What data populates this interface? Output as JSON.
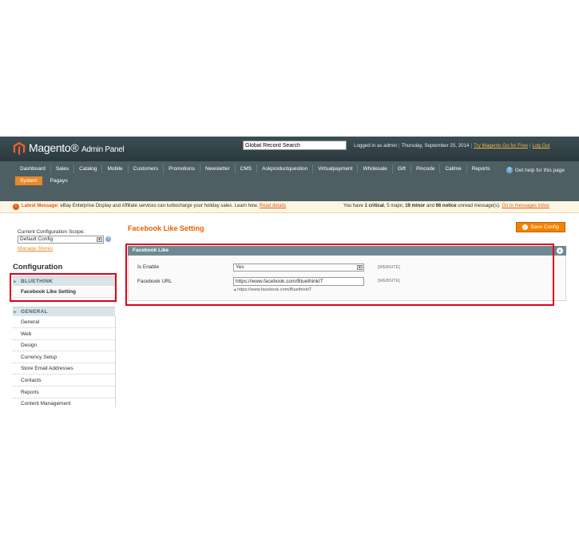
{
  "header": {
    "logo_text": "Magento",
    "logo_sub": "Admin Panel",
    "search_value": "Global Record Search",
    "user_text": "Logged in as admin",
    "date_text": "Thursday, September 25, 2014",
    "try_link": "Try Magento Go for Free",
    "logout_link": "Log Out"
  },
  "nav": {
    "row1": [
      "Dashboard",
      "Sales",
      "Catalog",
      "Mobile",
      "Customers",
      "Promotions",
      "Newsletter",
      "CMS",
      "Askproductquestion",
      "Virtualpayment",
      "Wholesale",
      "Gift",
      "Pincode",
      "Callme",
      "Reports"
    ],
    "row2": [
      "System",
      "Pagayo"
    ],
    "help": "Get help for this page"
  },
  "message": {
    "label": "Latest Message:",
    "text": "eBay Enterprise Display and Affiliate services can turbocharge your holiday sales. Learn how.",
    "read_details": "Read details",
    "summary_prefix": "You have",
    "critical": "1 critical",
    "major": "5 major",
    "minor": "19 minor",
    "notice": "66 notice",
    "summary_suffix": "unread message(s).",
    "inbox_link": "Go to messages inbox"
  },
  "sidebar": {
    "scope_label": "Current Configuration Scope:",
    "scope_value": "Default Config",
    "manage_stores": "Manage Stores",
    "title": "Configuration",
    "section1": "BLUETHINK",
    "section1_item": "Facebook Like Setting",
    "section2": "GENERAL",
    "items": [
      "General",
      "Web",
      "Design",
      "Currency Setup",
      "Store Email Addresses",
      "Contacts",
      "Reports",
      "Content Management"
    ]
  },
  "main": {
    "title": "Facebook Like Setting",
    "save_button": "Save Config",
    "fieldset_title": "Facebook Like",
    "enable_label": "Is Enable",
    "enable_value": "Yes",
    "url_label": "Facebook URL",
    "url_value": "https://www.facebook.com/BluethinkIT",
    "url_note": "https://www.facebook.com/BluethinkIT",
    "scope_tag": "[WEBSITE]"
  },
  "colors": {
    "accent_orange": "#eb5e00",
    "annotation_red": "#e0001b",
    "nav_bg": "#4e5f64"
  }
}
